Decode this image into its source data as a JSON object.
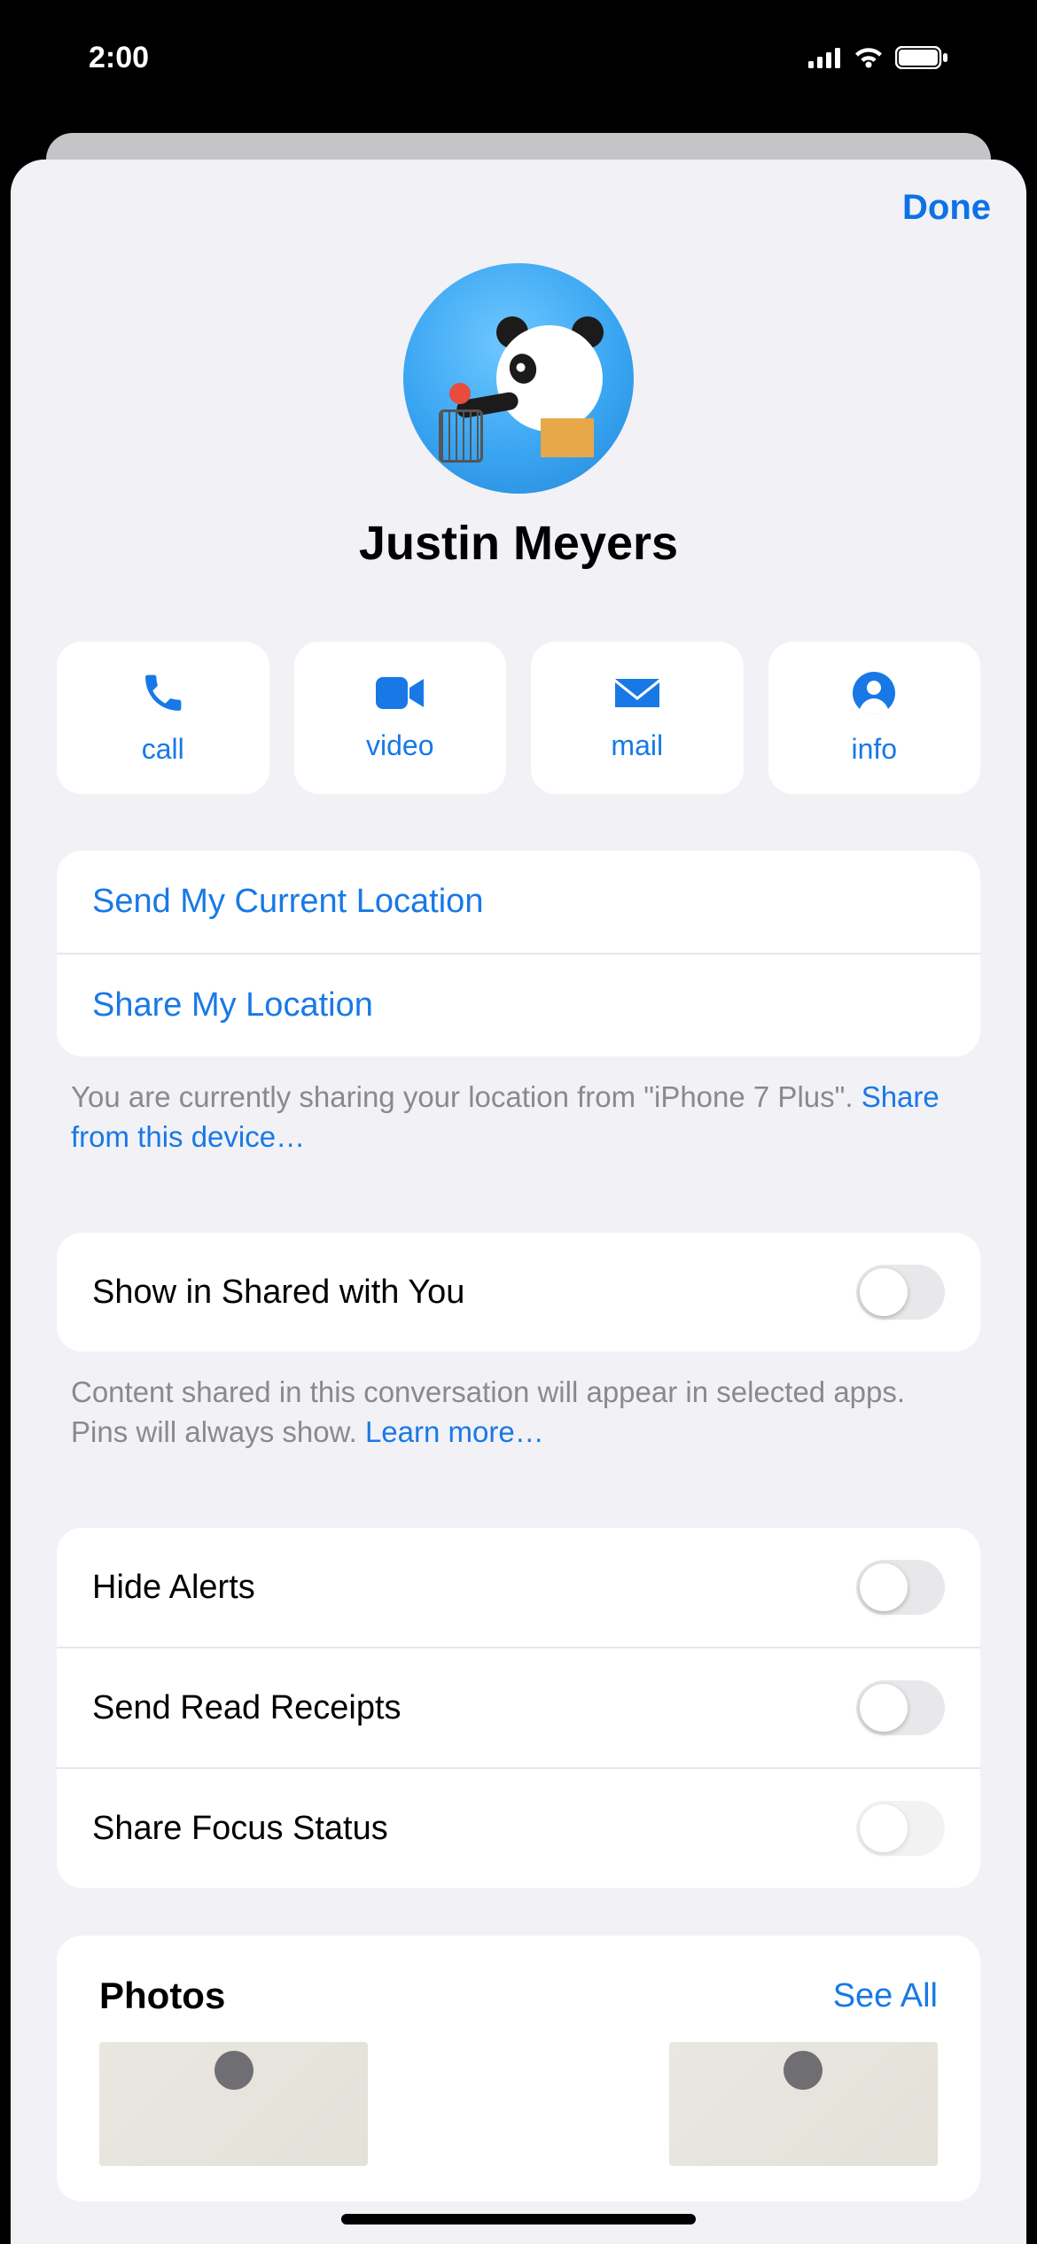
{
  "status": {
    "time": "2:00"
  },
  "nav": {
    "done_label": "Done"
  },
  "contact": {
    "name": "Justin Meyers"
  },
  "actions": {
    "call": "call",
    "video": "video",
    "mail": "mail",
    "info": "info"
  },
  "location_group": {
    "send_current": "Send My Current Location",
    "share": "Share My Location",
    "footer_prefix": "You are currently sharing your location from \"iPhone 7 Plus\". ",
    "footer_link": "Share from this device…"
  },
  "shared_with_you": {
    "label": "Show in Shared with You",
    "footer_prefix": "Content shared in this conversation will appear in selected apps. Pins will always show. ",
    "footer_link": "Learn more…"
  },
  "notifications_group": {
    "hide_alerts": "Hide Alerts",
    "read_receipts": "Send Read Receipts",
    "focus_status": "Share Focus Status"
  },
  "photos": {
    "title": "Photos",
    "see_all": "See All"
  },
  "toggles": {
    "shared_with_you": false,
    "hide_alerts": false,
    "read_receipts": false,
    "focus_status": false
  }
}
